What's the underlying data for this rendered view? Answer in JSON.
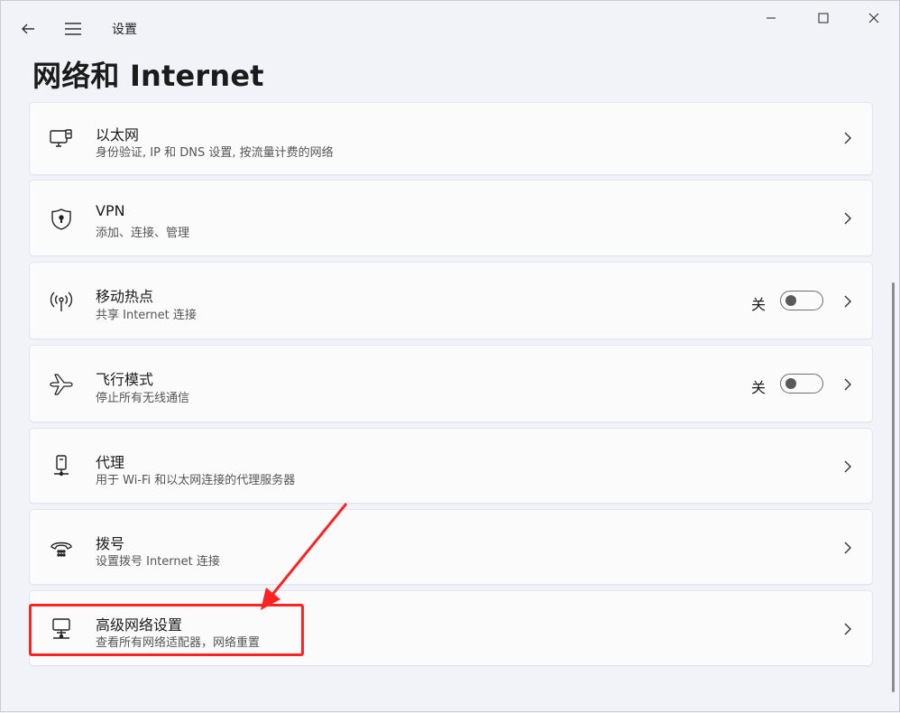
{
  "window": {
    "app_title": "设置",
    "page_title": "网络和 Internet"
  },
  "items": [
    {
      "title": "以太网",
      "subtitle": "身份验证, IP 和 DNS 设置, 按流量计费的网络",
      "icon": "ethernet-icon"
    },
    {
      "title": "VPN",
      "subtitle": "添加、连接、管理",
      "icon": "shield-icon"
    },
    {
      "title": "移动热点",
      "subtitle": "共享 Internet 连接",
      "icon": "hotspot-icon",
      "state": "关",
      "toggle_on": false
    },
    {
      "title": "飞行模式",
      "subtitle": "停止所有无线通信",
      "icon": "airplane-icon",
      "state": "关",
      "toggle_on": false
    },
    {
      "title": "代理",
      "subtitle": "用于 Wi-Fi 和以太网连接的代理服务器",
      "icon": "proxy-icon"
    },
    {
      "title": "拨号",
      "subtitle": "设置拨号 Internet 连接",
      "icon": "dialup-icon"
    },
    {
      "title": "高级网络设置",
      "subtitle": "查看所有网络适配器，网络重置",
      "icon": "network-adapter-icon"
    }
  ],
  "annotation": {
    "color": "#ff2222"
  }
}
